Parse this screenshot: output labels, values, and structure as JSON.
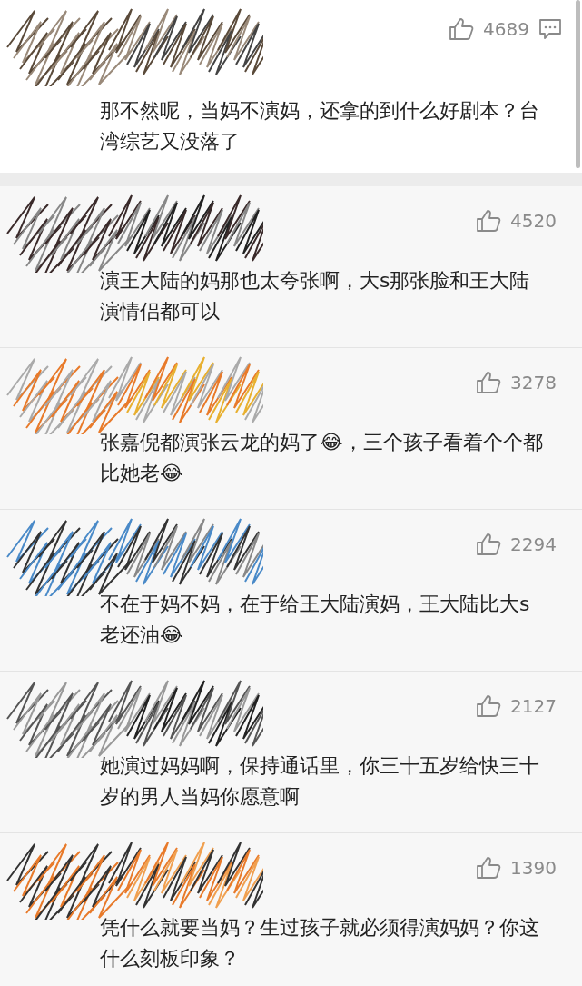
{
  "comments": [
    {
      "kind": "top",
      "likes": "4689",
      "text": "那不然呢，当妈不演妈，还拿的到什么好剧本？台湾综艺又没落了"
    },
    {
      "kind": "reply",
      "likes": "4520",
      "text": "演王大陆的妈那也太夸张啊，大s那张脸和王大陆演情侣都可以"
    },
    {
      "kind": "reply",
      "likes": "3278",
      "text": "张嘉倪都演张云龙的妈了😂，三个孩子看着个个都比她老😂"
    },
    {
      "kind": "reply",
      "likes": "2294",
      "text": "不在于妈不妈，在于给王大陆演妈，王大陆比大s老还油😂"
    },
    {
      "kind": "reply",
      "likes": "2127",
      "text": "她演过妈妈啊，保持通话里，你三十五岁给快三十岁的男人当妈你愿意啊"
    },
    {
      "kind": "reply",
      "likes": "1390",
      "text": "凭什么就要当妈？生过孩子就必须得演妈妈？你这什么刻板印象？"
    }
  ]
}
